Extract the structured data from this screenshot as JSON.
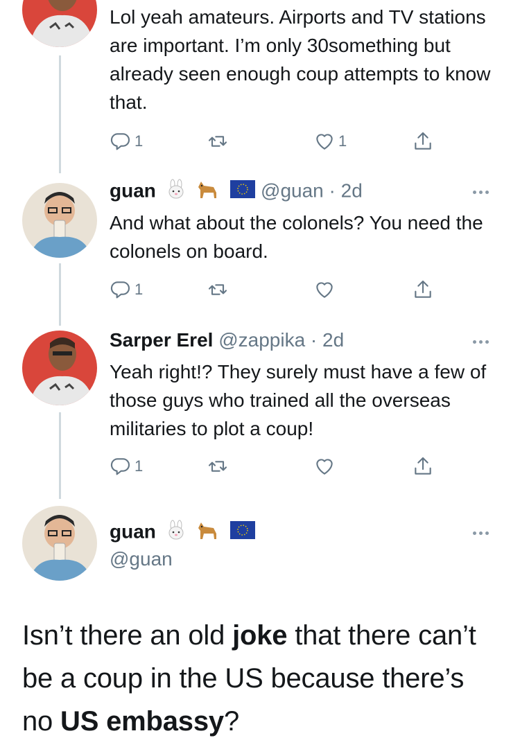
{
  "tweets": [
    {
      "text": "Lol yeah amateurs. Airports and TV stations are important. I’m only 30something but already seen enough coup attempts to know that.",
      "reply_count": "1",
      "retweet_count": "",
      "like_count": "1"
    },
    {
      "name": "guan",
      "emojis": [
        "rabbit-face",
        "dog",
        "eu-flag"
      ],
      "handle": "@guan",
      "time": "· 2d",
      "text": "And what about the colonels? You need the colonels on board.",
      "reply_count": "1",
      "retweet_count": "",
      "like_count": ""
    },
    {
      "name": "Sarper Erel",
      "handle": "@zappika",
      "time": "· 2d",
      "text": "Yeah right!? They surely must have a few of those guys who trained all the overseas militaries to plot a coup!",
      "reply_count": "1",
      "retweet_count": "",
      "like_count": ""
    }
  ],
  "main_tweet": {
    "name": "guan",
    "emojis": [
      "rabbit-face",
      "dog",
      "eu-flag"
    ],
    "handle": "@guan",
    "text_part1": "Isn’t there an old ",
    "bold1": "joke",
    "text_part2": " that there can’t be a coup in the US because there’s no ",
    "bold2": "US embassy",
    "text_part3": "?"
  },
  "icons": [
    "reply-icon",
    "retweet-icon",
    "like-icon",
    "share-icon",
    "more-icon"
  ],
  "colors": {
    "text": "#14171a",
    "secondary": "#657786",
    "thread_line": "#cfd9de",
    "avatar_bg_red": "#d9463b"
  }
}
